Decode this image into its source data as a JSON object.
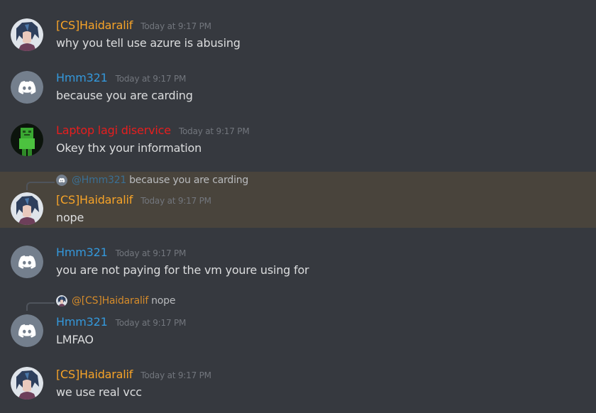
{
  "colors": {
    "background": "#36393f",
    "mention_highlight": "#49443c",
    "user_orange": "#f6a328",
    "user_blue": "#3498db",
    "user_red": "#e61e1e",
    "timestamp": "#72767d",
    "discord_blurple_gray": "#747f8d"
  },
  "messages": [
    {
      "username": "[CS]Haidaralif",
      "timestamp": "Today at 9:17 PM",
      "text": "why you tell use azure is abusing",
      "avatar": "anime-avatar"
    },
    {
      "username": "Hmm321",
      "timestamp": "Today at 9:17 PM",
      "text": "because you are carding",
      "avatar": "discord-default-avatar"
    },
    {
      "username": "Laptop lagi diservice",
      "timestamp": "Today at 9:17 PM",
      "text": "Okey thx your information",
      "avatar": "green-blocky-avatar"
    },
    {
      "username": "[CS]Haidaralif",
      "timestamp": "Today at 9:17 PM",
      "text": "nope",
      "avatar": "anime-avatar",
      "reply": {
        "name": "@Hmm321",
        "text": "because you are carding",
        "avatar": "discord-default-avatar"
      }
    },
    {
      "username": "Hmm321",
      "timestamp": "Today at 9:17 PM",
      "text": "you are not paying for the vm youre using for",
      "avatar": "discord-default-avatar"
    },
    {
      "username": "Hmm321",
      "timestamp": "Today at 9:17 PM",
      "text": "LMFAO",
      "avatar": "discord-default-avatar",
      "reply": {
        "name": "@[CS]Haidaralif",
        "text": "nope",
        "avatar": "anime-avatar"
      }
    },
    {
      "username": "[CS]Haidaralif",
      "timestamp": "Today at 9:17 PM",
      "text": "we use real vcc",
      "avatar": "anime-avatar"
    }
  ]
}
